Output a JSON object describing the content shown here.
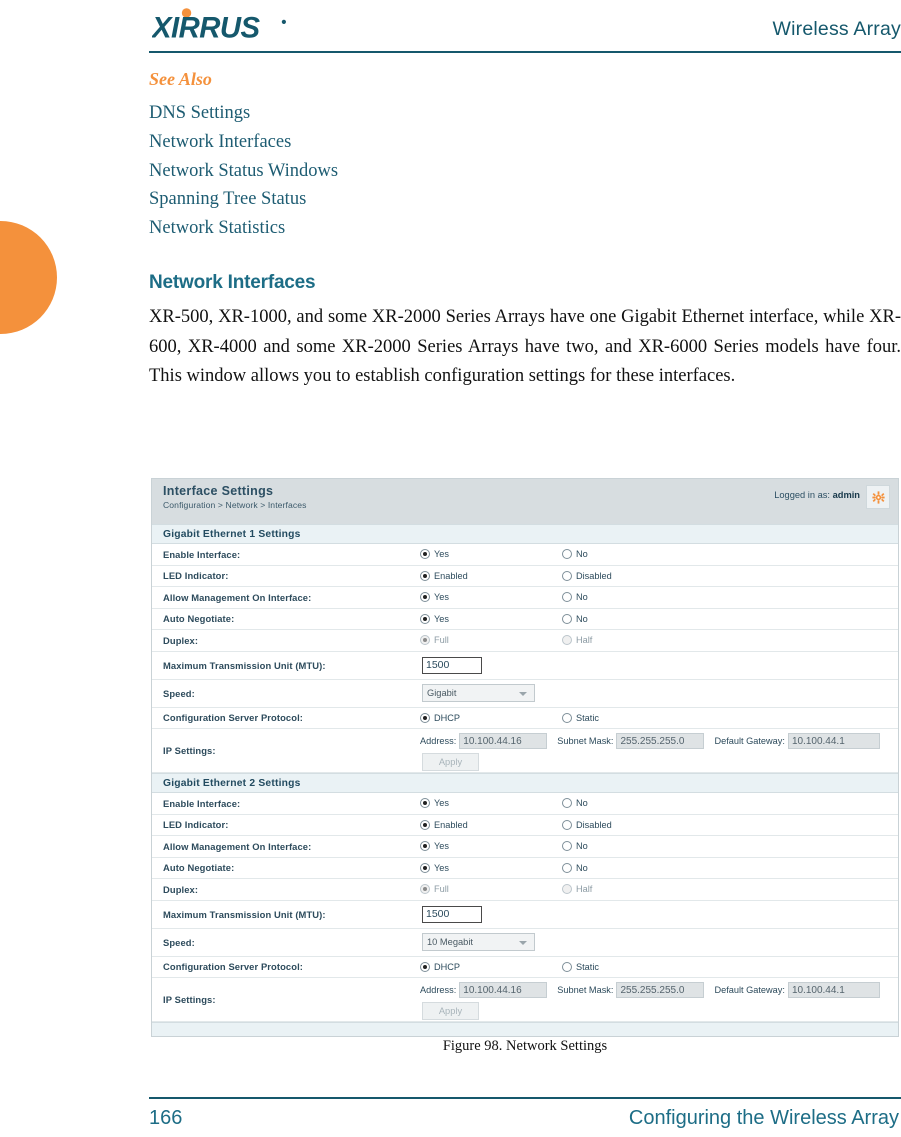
{
  "page": {
    "header_title": "Wireless Array",
    "logo_text": "XIRRUS",
    "see_also_heading": "See Also",
    "see_also_links": [
      "DNS Settings",
      "Network Interfaces",
      "Network Status Windows",
      "Spanning Tree Status",
      "Network Statistics"
    ],
    "section_heading": "Network Interfaces",
    "section_paragraph": "XR-500, XR-1000, and some XR-2000 Series Arrays have one Gigabit Ethernet interface, while XR- 600, XR-4000 and some XR-2000 Series Arrays have two, and XR-6000 Series models have four. This window allows you to establish configuration settings for these interfaces.",
    "figure_caption": "Figure 98. Network Settings",
    "footer_page_number": "166",
    "footer_chapter": "Configuring the Wireless Array"
  },
  "colors": {
    "accent_orange": "#f4913c",
    "brand_teal": "#15586c",
    "heading_teal": "#1d6d86",
    "panel_header_bg": "#d7dde0",
    "section_band_bg": "#eaf2f5"
  },
  "ui": {
    "title": "Interface Settings",
    "breadcrumb": "Configuration > Network > Interfaces",
    "login_status_prefix": "Logged in as:",
    "login_user": "admin",
    "gear_icon": "gear-icon",
    "sections": [
      {
        "band_label": "Gigabit Ethernet 1 Settings",
        "rows": [
          {
            "label": "Enable Interface:",
            "type": "radio",
            "options": [
              {
                "label": "Yes",
                "checked": true
              },
              {
                "label": "No",
                "checked": false
              }
            ]
          },
          {
            "label": "LED Indicator:",
            "type": "radio",
            "options": [
              {
                "label": "Enabled",
                "checked": true
              },
              {
                "label": "Disabled",
                "checked": false
              }
            ]
          },
          {
            "label": "Allow Management On Interface:",
            "type": "radio",
            "options": [
              {
                "label": "Yes",
                "checked": true
              },
              {
                "label": "No",
                "checked": false
              }
            ]
          },
          {
            "label": "Auto Negotiate:",
            "type": "radio",
            "options": [
              {
                "label": "Yes",
                "checked": true
              },
              {
                "label": "No",
                "checked": false
              }
            ]
          },
          {
            "label": "Duplex:",
            "type": "radio",
            "disabled": true,
            "options": [
              {
                "label": "Full",
                "checked": true
              },
              {
                "label": "Half",
                "checked": false
              }
            ]
          },
          {
            "label": "Maximum Transmission Unit (MTU):",
            "type": "text",
            "value": "1500"
          },
          {
            "label": "Speed:",
            "type": "select",
            "value": "Gigabit"
          },
          {
            "label": "Configuration Server Protocol:",
            "type": "radio",
            "options": [
              {
                "label": "DHCP",
                "checked": true
              },
              {
                "label": "Static",
                "checked": false
              }
            ]
          },
          {
            "label": "IP Settings:",
            "type": "ip",
            "address_label": "Address:",
            "address_value": "10.100.44.16",
            "mask_label": "Subnet Mask:",
            "mask_value": "255.255.255.0",
            "gateway_label": "Default Gateway:",
            "gateway_value": "10.100.44.1",
            "apply_label": "Apply"
          }
        ]
      },
      {
        "band_label": "Gigabit Ethernet 2 Settings",
        "rows": [
          {
            "label": "Enable Interface:",
            "type": "radio",
            "options": [
              {
                "label": "Yes",
                "checked": true
              },
              {
                "label": "No",
                "checked": false
              }
            ]
          },
          {
            "label": "LED Indicator:",
            "type": "radio",
            "options": [
              {
                "label": "Enabled",
                "checked": true
              },
              {
                "label": "Disabled",
                "checked": false
              }
            ]
          },
          {
            "label": "Allow Management On Interface:",
            "type": "radio",
            "options": [
              {
                "label": "Yes",
                "checked": true
              },
              {
                "label": "No",
                "checked": false
              }
            ]
          },
          {
            "label": "Auto Negotiate:",
            "type": "radio",
            "options": [
              {
                "label": "Yes",
                "checked": true
              },
              {
                "label": "No",
                "checked": false
              }
            ]
          },
          {
            "label": "Duplex:",
            "type": "radio",
            "disabled": true,
            "options": [
              {
                "label": "Full",
                "checked": true
              },
              {
                "label": "Half",
                "checked": false
              }
            ]
          },
          {
            "label": "Maximum Transmission Unit (MTU):",
            "type": "text",
            "value": "1500"
          },
          {
            "label": "Speed:",
            "type": "select",
            "value": "10 Megabit"
          },
          {
            "label": "Configuration Server Protocol:",
            "type": "radio",
            "options": [
              {
                "label": "DHCP",
                "checked": true
              },
              {
                "label": "Static",
                "checked": false
              }
            ]
          },
          {
            "label": "IP Settings:",
            "type": "ip",
            "address_label": "Address:",
            "address_value": "10.100.44.16",
            "mask_label": "Subnet Mask:",
            "mask_value": "255.255.255.0",
            "gateway_label": "Default Gateway:",
            "gateway_value": "10.100.44.1",
            "apply_label": "Apply"
          }
        ]
      }
    ]
  }
}
